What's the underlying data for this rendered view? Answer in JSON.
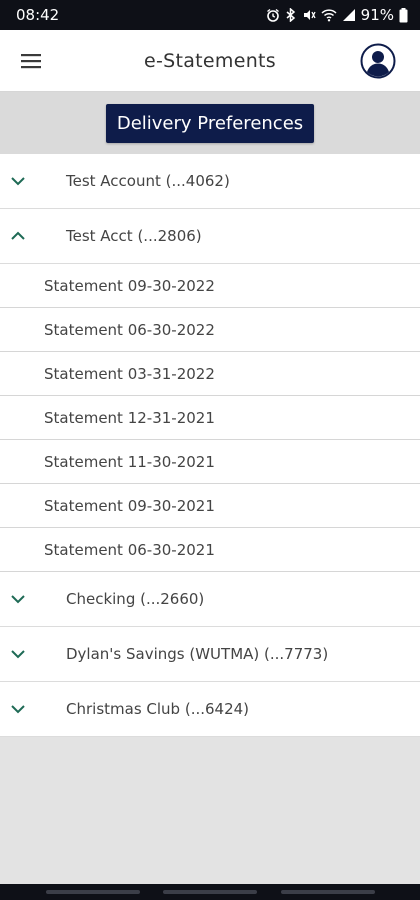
{
  "status_bar": {
    "time": "08:42",
    "battery": "91%",
    "icons": [
      "alarm-icon",
      "bluetooth-icon",
      "mute-icon",
      "wifi-icon",
      "signal-icon",
      "battery-icon"
    ]
  },
  "app_bar": {
    "title": "e-Statements",
    "menu_icon": "hamburger-menu-icon",
    "profile_icon": "user-profile-icon"
  },
  "delivery_preferences": {
    "label": "Delivery Preferences"
  },
  "accounts": [
    {
      "label": "Test Account (...4062)",
      "expanded": false
    },
    {
      "label": "Test Acct (...2806)",
      "expanded": true
    },
    {
      "label": "Checking (...2660)",
      "expanded": false
    },
    {
      "label": "Dylan's Savings (WUTMA) (...7773)",
      "expanded": false
    },
    {
      "label": "Christmas Club (...6424)",
      "expanded": false
    }
  ],
  "statements": [
    {
      "label": "Statement 09-30-2022"
    },
    {
      "label": "Statement 06-30-2022"
    },
    {
      "label": "Statement 03-31-2022"
    },
    {
      "label": "Statement 12-31-2021"
    },
    {
      "label": "Statement 11-30-2021"
    },
    {
      "label": "Statement 09-30-2021"
    },
    {
      "label": "Statement 06-30-2021"
    }
  ],
  "colors": {
    "accent": "#0e1c4a",
    "chevron": "#1e6a55",
    "status_bar": "#0e1017"
  }
}
